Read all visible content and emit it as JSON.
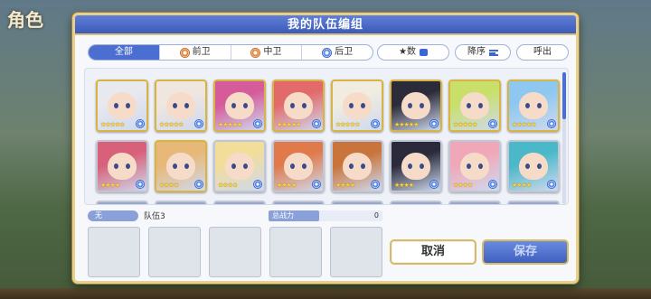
{
  "background": {
    "screen_title": "角色"
  },
  "dialog": {
    "title": "我的队伍编组",
    "filters": [
      {
        "label": "全部",
        "active": true
      },
      {
        "label": "前卫",
        "active": false,
        "icon": "vanguard-role-icon"
      },
      {
        "label": "中卫",
        "active": false,
        "icon": "middle-role-icon"
      },
      {
        "label": "后卫",
        "active": false,
        "icon": "rearguard-role-icon"
      }
    ],
    "sort_key_label": "★数",
    "sort_order_label": "降序",
    "call_label": "呼出",
    "team": {
      "none_badge": "无",
      "name": "队伍3",
      "power_label": "总战力",
      "power_value": "0"
    },
    "cancel_label": "取消",
    "save_label": "保存"
  },
  "characters": [
    {
      "stars": "★★★★★",
      "hair": "#e8e8ef",
      "frame": "gold"
    },
    {
      "stars": "★★★★★",
      "hair": "#efe6e0",
      "frame": "gold"
    },
    {
      "stars": "★★★★★",
      "hair": "#d55b9b",
      "frame": "gold"
    },
    {
      "stars": "★★★★★",
      "hair": "#e36a6a",
      "frame": "gold"
    },
    {
      "stars": "★★★★★",
      "hair": "#f0ede0",
      "frame": "gold"
    },
    {
      "stars": "★★★★★",
      "hair": "#2b2b3a",
      "frame": "gold"
    },
    {
      "stars": "★★★★★",
      "hair": "#c8e06a",
      "frame": "gold"
    },
    {
      "stars": "★★★★★",
      "hair": "#8ec8f0",
      "frame": "gold"
    },
    {
      "stars": "★★★★",
      "hair": "#d8607a",
      "frame": "silver"
    },
    {
      "stars": "★★★★",
      "hair": "#e8b878",
      "frame": "gold"
    },
    {
      "stars": "★★★★",
      "hair": "#f2dd9a",
      "frame": "silver"
    },
    {
      "stars": "★★★★",
      "hair": "#e07a4a",
      "frame": "silver"
    },
    {
      "stars": "★★★★",
      "hair": "#c8743a",
      "frame": "silver"
    },
    {
      "stars": "★★★★",
      "hair": "#2a2a3a",
      "frame": "silver"
    },
    {
      "stars": "★★★★",
      "hair": "#f0a8b8",
      "frame": "silver"
    },
    {
      "stars": "★★★★",
      "hair": "#4ab8c8",
      "frame": "silver"
    }
  ]
}
